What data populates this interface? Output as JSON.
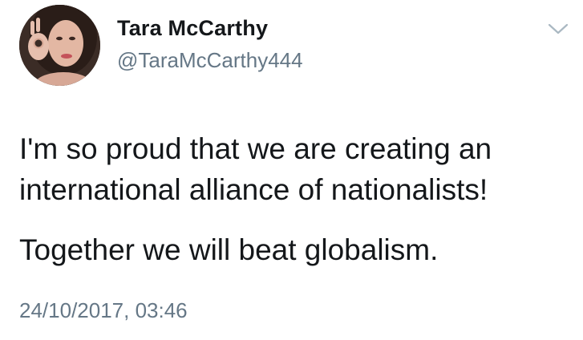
{
  "tweet": {
    "author": {
      "display_name": "Tara McCarthy",
      "handle": "@TaraMcCarthy444",
      "avatar_icon": "profile-photo"
    },
    "menu_icon": "chevron-down-icon",
    "text_lines": [
      "I'm so proud that we are creating an",
      "international alliance of nationalists!"
    ],
    "text_paragraph_2": "Together we will beat globalism.",
    "timestamp": "24/10/2017, 03:46"
  },
  "colors": {
    "text_primary": "#14171a",
    "text_secondary": "#657786",
    "chevron": "#aab8c2",
    "background": "#ffffff"
  }
}
